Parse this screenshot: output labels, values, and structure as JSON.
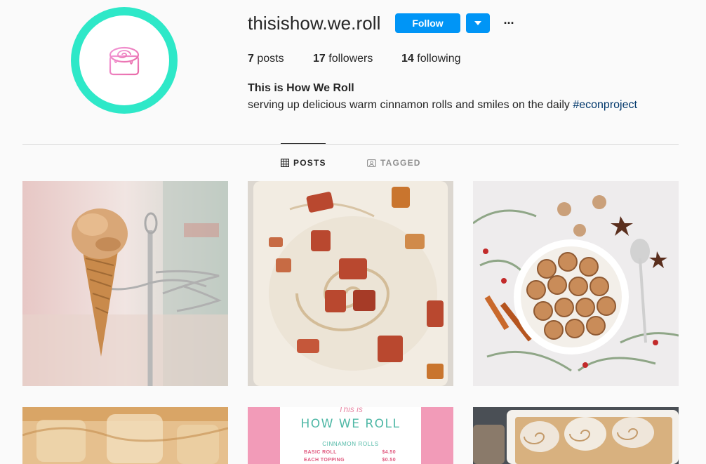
{
  "profile": {
    "username": "thisishow.we.roll",
    "follow_label": "Follow",
    "more_label": "···",
    "stats": {
      "posts_count": "7",
      "posts_label": " posts",
      "followers_count": "17",
      "followers_label": " followers",
      "following_count": "14",
      "following_label": " following"
    },
    "full_name": "This is How We Roll",
    "bio_text": "serving up delicious warm cinnamon rolls and smiles on the daily ",
    "bio_hashtag": "#econproject"
  },
  "tabs": {
    "posts_label": "POSTS",
    "tagged_label": "TAGGED"
  },
  "posts": {
    "menu_tile": {
      "subtitle": "This is",
      "title": "HOW WE ROLL",
      "section": "CINNAMON ROLLS",
      "rows": [
        {
          "item": "BASIC ROLL",
          "price": "$4.50"
        },
        {
          "item": "EACH TOPPING",
          "price": "$0.50"
        }
      ]
    }
  },
  "colors": {
    "accent": "#0095f6",
    "avatar_ring": "#2ee8c8",
    "hashtag": "#00376b"
  },
  "icons": {
    "avatar": "cinnamon-roll-icon",
    "dropdown": "caret-down-icon",
    "posts_tab": "grid-icon",
    "tagged_tab": "tag-portrait-icon"
  }
}
